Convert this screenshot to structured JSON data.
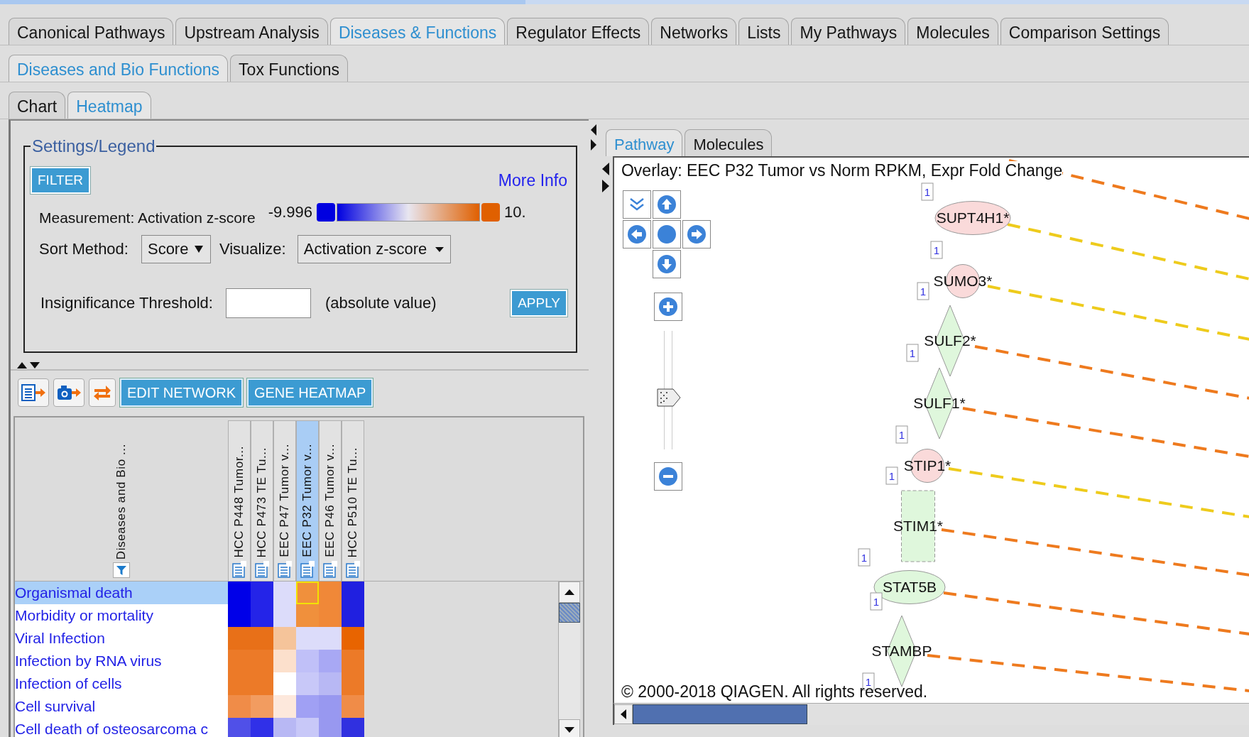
{
  "main_tabs": [
    {
      "label": "Canonical Pathways",
      "selected": false
    },
    {
      "label": "Upstream Analysis",
      "selected": false
    },
    {
      "label": "Diseases & Functions",
      "selected": true
    },
    {
      "label": "Regulator Effects",
      "selected": false
    },
    {
      "label": "Networks",
      "selected": false
    },
    {
      "label": "Lists",
      "selected": false
    },
    {
      "label": "My Pathways",
      "selected": false
    },
    {
      "label": "Molecules",
      "selected": false
    },
    {
      "label": "Comparison Settings",
      "selected": false
    }
  ],
  "sub_tabs": [
    {
      "label": "Diseases and Bio Functions",
      "selected": true
    },
    {
      "label": "Tox Functions",
      "selected": false
    }
  ],
  "view_tabs": [
    {
      "label": "Chart",
      "selected": false
    },
    {
      "label": "Heatmap",
      "selected": true
    }
  ],
  "settings": {
    "title": "Settings/Legend",
    "filter_button": "FILTER",
    "more_info_link": "More Info",
    "measurement": "Measurement: Activation z-score",
    "range_min": "-9.996",
    "range_max": "10.",
    "sort_label": "Sort Method:",
    "sort_value": "Score",
    "visualize_label": "Visualize:",
    "visualize_value": "Activation z-score",
    "threshold_label": "Insignificance Threshold:",
    "threshold_hint": "(absolute value)",
    "apply_button": "APPLY"
  },
  "toolbar": {
    "buttons": [
      "EDIT NETWORK",
      "GENE HEATMAP"
    ]
  },
  "heatmap": {
    "row_header": "Diseases and Bio ...",
    "columns": [
      {
        "label": "HCC P448 Tumor...",
        "selected": false
      },
      {
        "label": "HCC P473 TE Tu...",
        "selected": false
      },
      {
        "label": "EEC P47 Tumor v...",
        "selected": false
      },
      {
        "label": "EEC P32 Tumor v...",
        "selected": true
      },
      {
        "label": "EEC P46 Tumor v...",
        "selected": false
      },
      {
        "label": "HCC P510 TE Tu...",
        "selected": false
      }
    ],
    "rows": [
      {
        "label": "Organismal death",
        "selected": true,
        "cells": [
          {
            "color": "#0000e8",
            "selected": false
          },
          {
            "color": "#2424e8",
            "selected": false
          },
          {
            "color": "#dcdcfa",
            "selected": false
          },
          {
            "color": "#f0903c",
            "selected": true
          },
          {
            "color": "#f08838",
            "selected": false
          },
          {
            "color": "#2020e0",
            "selected": false
          }
        ]
      },
      {
        "label": "Morbidity or mortality",
        "selected": false,
        "cells": [
          {
            "color": "#0000e8",
            "selected": false
          },
          {
            "color": "#2424e8",
            "selected": false
          },
          {
            "color": "#dcdcfa",
            "selected": false
          },
          {
            "color": "#f0903c",
            "selected": false
          },
          {
            "color": "#f08838",
            "selected": false
          },
          {
            "color": "#2020e0",
            "selected": false
          }
        ]
      },
      {
        "label": "Viral Infection",
        "selected": false,
        "cells": [
          {
            "color": "#e87018",
            "selected": false
          },
          {
            "color": "#e87018",
            "selected": false
          },
          {
            "color": "#f5c49a",
            "selected": false
          },
          {
            "color": "#dcdcfa",
            "selected": false
          },
          {
            "color": "#dcdcfa",
            "selected": false
          },
          {
            "color": "#e86400",
            "selected": false
          }
        ]
      },
      {
        "label": "Infection by RNA virus",
        "selected": false,
        "cells": [
          {
            "color": "#ec7a28",
            "selected": false
          },
          {
            "color": "#ec7a28",
            "selected": false
          },
          {
            "color": "#fce0cc",
            "selected": false
          },
          {
            "color": "#c0c0f8",
            "selected": false
          },
          {
            "color": "#a8a8f4",
            "selected": false
          },
          {
            "color": "#ec7a28",
            "selected": false
          }
        ]
      },
      {
        "label": "Infection of cells",
        "selected": false,
        "cells": [
          {
            "color": "#ec7a28",
            "selected": false
          },
          {
            "color": "#ec7a28",
            "selected": false
          },
          {
            "color": "#ffffff",
            "selected": false
          },
          {
            "color": "#c8c8f8",
            "selected": false
          },
          {
            "color": "#b8b8f4",
            "selected": false
          },
          {
            "color": "#ec7a28",
            "selected": false
          }
        ]
      },
      {
        "label": "Cell survival",
        "selected": false,
        "cells": [
          {
            "color": "#f08c48",
            "selected": false
          },
          {
            "color": "#f29c60",
            "selected": false
          },
          {
            "color": "#fde8dc",
            "selected": false
          },
          {
            "color": "#a0a0f4",
            "selected": false
          },
          {
            "color": "#9898f0",
            "selected": false
          },
          {
            "color": "#f08c48",
            "selected": false
          }
        ]
      },
      {
        "label": "Cell death of osteosarcoma c",
        "selected": false,
        "cells": [
          {
            "color": "#5050e8",
            "selected": false
          },
          {
            "color": "#3030e8",
            "selected": false
          },
          {
            "color": "#b8b8f4",
            "selected": false
          },
          {
            "color": "#c8c8f8",
            "selected": false
          },
          {
            "color": "#9898f0",
            "selected": false
          },
          {
            "color": "#3030e0",
            "selected": false
          }
        ]
      }
    ]
  },
  "pathway_panel": {
    "tabs": [
      {
        "label": "Pathway",
        "selected": true
      },
      {
        "label": "Molecules",
        "selected": false
      }
    ],
    "overlay_title": "Overlay: EEC P32 Tumor vs Norm RPKM, Expr Fold Change",
    "zoom": {
      "level": 0.44
    },
    "nodes": [
      {
        "kind": "ellipse",
        "label": "SUPT4H1*",
        "color": "#fadada"
      },
      {
        "kind": "circle",
        "label": "SUMO3*",
        "color": "#fadada"
      },
      {
        "kind": "diamond",
        "label": "SULF2*",
        "color": "#dff7dc"
      },
      {
        "kind": "diamond",
        "label": "SULF1*",
        "color": "#dff7dc"
      },
      {
        "kind": "circle",
        "label": "STIP1*",
        "color": "#fadada"
      },
      {
        "kind": "dashed-rectangle",
        "label": "STIM1*",
        "color": "#dff7dc"
      },
      {
        "kind": "ellipse",
        "label": "STAT5B",
        "color": "#dff7dc"
      },
      {
        "kind": "diamond",
        "label": "STAMBP",
        "color": "#dff7dc"
      }
    ],
    "edges": [
      {
        "color": "#ee7a1e"
      },
      {
        "color": "#eecb1c"
      },
      {
        "color": "#eecb1c"
      },
      {
        "color": "#ee7a1e"
      },
      {
        "color": "#ee7a1e"
      },
      {
        "color": "#eecb1c"
      },
      {
        "color": "#ee7a1e"
      },
      {
        "color": "#ee7a1e"
      },
      {
        "color": "#ee7a1e"
      }
    ],
    "count_badges": [
      "1",
      "1",
      "1",
      "1",
      "1",
      "1",
      "1",
      "1",
      "1"
    ],
    "copyright": "© 2000-2018 QIAGEN. All rights reserved."
  }
}
